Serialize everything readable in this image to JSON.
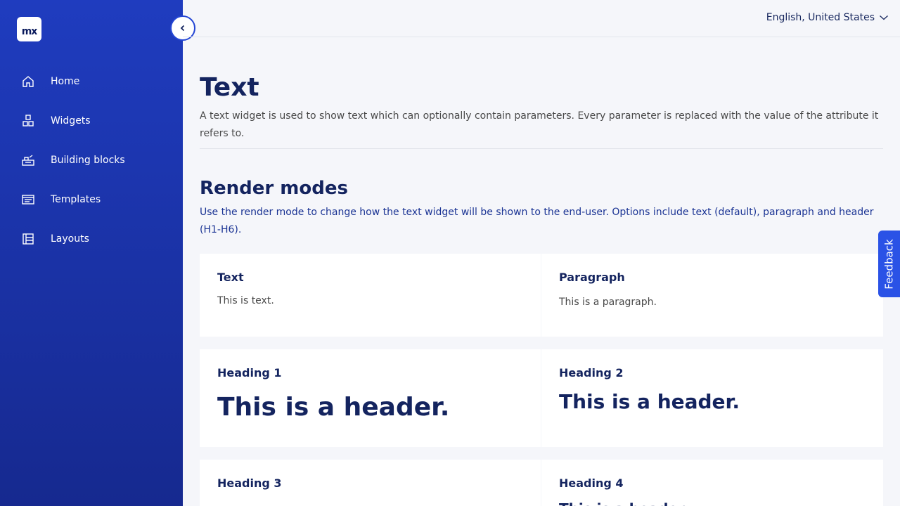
{
  "logo": {
    "text": "mx"
  },
  "sidebar": {
    "items": [
      {
        "label": "Home",
        "icon": "home-icon"
      },
      {
        "label": "Widgets",
        "icon": "widgets-icon"
      },
      {
        "label": "Building blocks",
        "icon": "building-blocks-icon"
      },
      {
        "label": "Templates",
        "icon": "templates-icon"
      },
      {
        "label": "Layouts",
        "icon": "layouts-icon"
      }
    ]
  },
  "header": {
    "language": "English, United States"
  },
  "main": {
    "title": "Text",
    "description": "A text widget is used to show text which can optionally contain parameters. Every parameter is replaced with the value of the attribute it refers to.",
    "section_title": "Render modes",
    "section_description": "Use the render mode to change how the text widget will be shown to the end-user. Options include text (default), paragraph and header (H1-H6).",
    "cards": [
      {
        "label": "Text",
        "sample": "This is text."
      },
      {
        "label": "Paragraph",
        "sample": "This is a paragraph."
      },
      {
        "label": "Heading 1",
        "sample": "This is a header."
      },
      {
        "label": "Heading 2",
        "sample": "This is a header."
      },
      {
        "label": "Heading 3",
        "sample": ""
      },
      {
        "label": "Heading 4",
        "sample": "This is a header."
      }
    ]
  },
  "feedback": {
    "label": "Feedback"
  },
  "colors": {
    "sidebar_top": "#1f3cbf",
    "sidebar_bottom": "#16298f",
    "accent": "#2a52e6",
    "heading": "#14245f"
  }
}
